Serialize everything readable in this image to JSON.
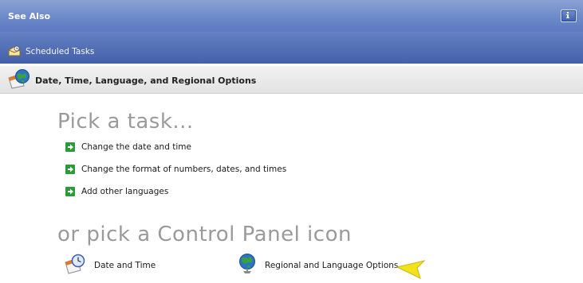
{
  "see_also": {
    "title": "See Also",
    "items": [
      {
        "label": "Scheduled Tasks",
        "icon": "scheduled-tasks-icon"
      }
    ],
    "info_icon": "info-icon"
  },
  "category": {
    "title": "Date, Time, Language, and Regional Options",
    "icon": "date-time-language-icon"
  },
  "tasks": {
    "heading": "Pick a task...",
    "items": [
      {
        "label": "Change the date and time"
      },
      {
        "label": "Change the format of numbers, dates, and times"
      },
      {
        "label": "Add other languages"
      }
    ]
  },
  "control_panel": {
    "heading": "or pick a Control Panel icon",
    "icons": [
      {
        "label": "Date and Time",
        "icon": "date-time-icon"
      },
      {
        "label": "Regional and Language Options",
        "icon": "globe-icon"
      }
    ]
  },
  "colors": {
    "band": "#5674bd",
    "task_arrow": "#2d9a3a",
    "heading_gray": "#9a9a9a",
    "pointer": "#f2e21a"
  }
}
